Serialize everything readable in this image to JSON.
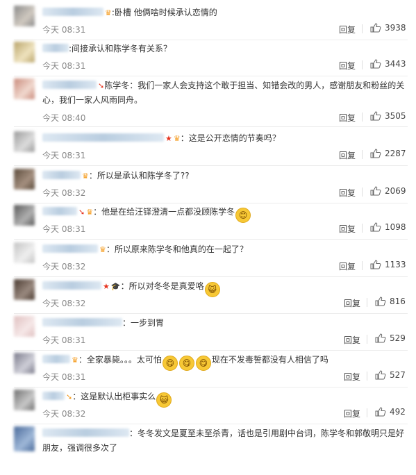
{
  "comments": [
    {
      "avatar_colors": [
        "#8a8a8a",
        "#d0c9c0"
      ],
      "badges": [
        "crown-orange"
      ],
      "text": ":卧槽 他俩啥时候承认恋情的",
      "time": "今天 08:31",
      "reply": "回复",
      "likes": "3938"
    },
    {
      "avatar_colors": [
        "#b9a46a",
        "#efe3bf"
      ],
      "badges": [],
      "text": ":间接承认和陈学冬有关系？",
      "time": "今天 08:31",
      "reply": "回复",
      "likes": "3443"
    },
    {
      "avatar_colors": [
        "#c98a7b",
        "#f1d9cf"
      ],
      "badges": [
        "arrow-red"
      ],
      "text": "陈学冬：我们一家人会支持这个敢于担当、知错会改的男人，感谢朋友和粉丝的关心，我们一家人风雨同舟。",
      "time": "今天 08:40",
      "reply": "回复",
      "likes": "3505"
    },
    {
      "avatar_colors": [
        "#9a9a9a",
        "#dcdcdc"
      ],
      "badges": [
        "star-red",
        "crown-orange"
      ],
      "text": "：这是公开恋情的节奏吗？",
      "time": "今天 08:31",
      "reply": "回复",
      "likes": "2287"
    },
    {
      "avatar_colors": [
        "#5a4a3a",
        "#a59080"
      ],
      "badges": [
        "crown-orange"
      ],
      "text": "：所以是承认和陈学冬了??",
      "time": "今天 08:32",
      "reply": "回复",
      "likes": "2069"
    },
    {
      "avatar_colors": [
        "#5a5a5a",
        "#b0b0b0"
      ],
      "badges": [
        "arrow-red",
        "crown-orange"
      ],
      "text": "：他是在给汪铎澄清一点都没顾陈学冬",
      "emoji": [
        "😊"
      ],
      "time": "今天 08:31",
      "reply": "回复",
      "likes": "1098"
    },
    {
      "avatar_colors": [
        "#c3c3c3",
        "#efefef"
      ],
      "badges": [
        "crown-orange"
      ],
      "text": "：所以原来陈学冬和他真的在一起了？",
      "time": "今天 08:32",
      "reply": "回复",
      "likes": "1133"
    },
    {
      "avatar_colors": [
        "#4a3a30",
        "#9a8a80"
      ],
      "badges": [
        "star-red",
        "grad-dark"
      ],
      "text": "：所以对冬冬是真爱咯",
      "emoji": [
        "😺"
      ],
      "time": "今天 08:32",
      "reply": "回复",
      "likes": "816"
    },
    {
      "avatar_colors": [
        "#e0c0c0",
        "#f6e8e8"
      ],
      "badges": [],
      "text": "：一步到胃",
      "time": "今天 08:31",
      "reply": "回复",
      "likes": "529"
    },
    {
      "avatar_colors": [
        "#7a7a8a",
        "#cfcfd8"
      ],
      "badges": [
        "crown-orange"
      ],
      "text": "：全家暴毙。。。太可怕",
      "emoji": [
        "😋",
        "😋",
        "😋"
      ],
      "text2": "现在不发毒誓都没有人相信了吗",
      "time": "今天 08:31",
      "reply": "回复",
      "likes": "527"
    },
    {
      "avatar_colors": [
        "#707070",
        "#c8c8c8"
      ],
      "badges": [
        "arrow-orange"
      ],
      "text": "：这是默认出柜事实么",
      "emoji": [
        "😺"
      ],
      "time": "今天 08:32",
      "reply": "回复",
      "likes": "492"
    },
    {
      "avatar_colors": [
        "#4a6a9a",
        "#9fb8d8"
      ],
      "badges": [],
      "text": "：冬冬发文是夏至未至杀青，话也是引用剧中台词，陈学冬和郭敬明只是好朋友，强调很多次了",
      "time": "",
      "reply": "",
      "likes": ""
    }
  ],
  "colors": {
    "accent": "#f59a1b",
    "link": "#eb7350",
    "text": "#333333",
    "meta": "#888888"
  }
}
